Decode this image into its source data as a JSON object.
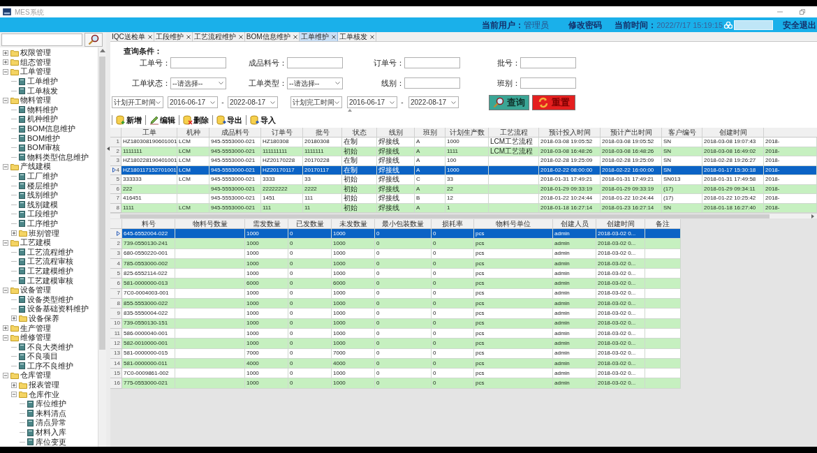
{
  "window": {
    "title": "MES系统"
  },
  "header": {
    "user_label": "当前用户：",
    "user_name": "管理员",
    "change_password": "修改密码",
    "time_label": "当前时间：",
    "time_value": "2022/7/17 15:19:15",
    "logout": "安全退出"
  },
  "sidebar": {
    "tree": [
      {
        "label": "权限管理",
        "kind": "folder",
        "expanded": false
      },
      {
        "label": "组态管理",
        "kind": "folder",
        "expanded": false
      },
      {
        "label": "工单管理",
        "kind": "folder",
        "expanded": true,
        "children": [
          {
            "label": "工单维护",
            "kind": "page"
          },
          {
            "label": "工单核发",
            "kind": "page"
          }
        ]
      },
      {
        "label": "物料管理",
        "kind": "folder",
        "expanded": true,
        "children": [
          {
            "label": "物料维护",
            "kind": "page"
          },
          {
            "label": "机种维护",
            "kind": "page"
          },
          {
            "label": "BOM信息维护",
            "kind": "page"
          },
          {
            "label": "BOM维护",
            "kind": "page"
          },
          {
            "label": "BOM审核",
            "kind": "page"
          },
          {
            "label": "物料类型信息维护",
            "kind": "page"
          }
        ]
      },
      {
        "label": "产线建模",
        "kind": "folder",
        "expanded": true,
        "children": [
          {
            "label": "工厂维护",
            "kind": "page"
          },
          {
            "label": "楼层维护",
            "kind": "page"
          },
          {
            "label": "线别维护",
            "kind": "page"
          },
          {
            "label": "线别建模",
            "kind": "page"
          },
          {
            "label": "工段维护",
            "kind": "page"
          },
          {
            "label": "工序维护",
            "kind": "page"
          },
          {
            "label": "班别管理",
            "kind": "folder",
            "expanded": false
          }
        ]
      },
      {
        "label": "工艺建模",
        "kind": "folder",
        "expanded": true,
        "children": [
          {
            "label": "工艺流程维护",
            "kind": "page"
          },
          {
            "label": "工艺流程审核",
            "kind": "page"
          },
          {
            "label": "工艺建模维护",
            "kind": "page"
          },
          {
            "label": "工艺建模审核",
            "kind": "page"
          }
        ]
      },
      {
        "label": "设备管理",
        "kind": "folder",
        "expanded": true,
        "children": [
          {
            "label": "设备类型维护",
            "kind": "page"
          },
          {
            "label": "设备基础资料维护",
            "kind": "page"
          },
          {
            "label": "设备保养",
            "kind": "folder",
            "expanded": false
          }
        ]
      },
      {
        "label": "生产管理",
        "kind": "folder",
        "expanded": false
      },
      {
        "label": "维修管理",
        "kind": "folder",
        "expanded": true,
        "children": [
          {
            "label": "不良大类维护",
            "kind": "page"
          },
          {
            "label": "不良项目",
            "kind": "page"
          },
          {
            "label": "工序不良维护",
            "kind": "page"
          }
        ]
      },
      {
        "label": "仓库管理",
        "kind": "folder",
        "expanded": true,
        "children": [
          {
            "label": "报表管理",
            "kind": "folder",
            "expanded": false
          },
          {
            "label": "仓库作业",
            "kind": "folder",
            "expanded": true,
            "children": [
              {
                "label": "库位维护",
                "kind": "page"
              },
              {
                "label": "来料清点",
                "kind": "page"
              },
              {
                "label": "清点异常",
                "kind": "page"
              },
              {
                "label": "材料入库",
                "kind": "page"
              },
              {
                "label": "库位变更",
                "kind": "page"
              }
            ]
          }
        ]
      }
    ]
  },
  "tabs": [
    {
      "label": "IQC送检单",
      "selected": false
    },
    {
      "label": "工段维护",
      "selected": false
    },
    {
      "label": "工艺流程维护",
      "selected": false
    },
    {
      "label": "BOM信息维护",
      "selected": false
    },
    {
      "label": "工单维护",
      "selected": true
    },
    {
      "label": "工单核发",
      "selected": false
    }
  ],
  "query": {
    "title": "查询条件：",
    "fields": [
      {
        "label": "工单号：",
        "kind": "text"
      },
      {
        "label": "成品料号：",
        "kind": "text"
      },
      {
        "label": "订单号：",
        "kind": "text"
      },
      {
        "label": "批号：",
        "kind": "text"
      },
      {
        "label": "工单状态：",
        "kind": "select",
        "value": "--请选择--"
      },
      {
        "label": "工单类型：",
        "kind": "select",
        "value": "--请选择--"
      },
      {
        "label": "线别：",
        "kind": "text"
      },
      {
        "label": "班别：",
        "kind": "text"
      }
    ],
    "range": [
      {
        "kind": "select",
        "value": "计划开工时间"
      },
      {
        "kind": "date",
        "value": "2016-06-17"
      },
      {
        "kind": "dash",
        "value": "-"
      },
      {
        "kind": "date",
        "value": "2022-08-17"
      },
      {
        "kind": "select",
        "value": "计划完工时间"
      },
      {
        "kind": "date",
        "value": "2016-06-17"
      },
      {
        "kind": "dash",
        "value": "-"
      },
      {
        "kind": "date",
        "value": "2022-08-17"
      }
    ],
    "buttons": [
      {
        "label": "查询",
        "kind": "search"
      },
      {
        "label": "重置",
        "kind": "reset"
      }
    ]
  },
  "toolbar": [
    {
      "label": "新增",
      "kind": "add"
    },
    {
      "label": "编辑",
      "kind": "edit"
    },
    {
      "label": "删除",
      "kind": "delete"
    },
    {
      "label": "导出",
      "kind": "export"
    },
    {
      "label": "导入",
      "kind": "import"
    }
  ],
  "work_orders": {
    "columns": [
      "工单",
      "机种",
      "成品料号",
      "订单号",
      "批号",
      "状态",
      "线别",
      "班别",
      "计划生产数",
      "工艺流程",
      "预计投入时间",
      "预计产出时间",
      "客户编号",
      "创建时间"
    ],
    "rows": [
      {
        "no": "1",
        "selected": false,
        "cells": [
          "HZ180308190601001",
          "LCM",
          "945-5553000-021",
          "HZ180308",
          "20180308",
          "在制",
          "焊接线",
          "A",
          "1000",
          "LCM工艺流程",
          "2018-03-08 19:05:52",
          "2018-03-08 19:05:52",
          "SN",
          "2018-03-08 19:07:43",
          "2018-"
        ]
      },
      {
        "no": "2",
        "selected": false,
        "cells": [
          "1111111",
          "LCM",
          "945-5553000-021",
          "111111111",
          "1111111",
          "初始",
          "焊接线",
          "A",
          "1111",
          "LCM工艺流程",
          "2018-03-08 16:48:26",
          "2018-03-08 16:48:26",
          "SN",
          "2018-03-08 16:49:02",
          "2018-"
        ]
      },
      {
        "no": "3",
        "selected": false,
        "cells": [
          "HZ180228190401001",
          "LCM",
          "945-5553000-021",
          "HZ20170228",
          "20170228",
          "在制",
          "焊接线",
          "A",
          "100",
          null,
          "2018-02-28 19:25:09",
          "2018-02-28 19:25:09",
          "SN",
          "2018-02-28 19:26:27",
          "2018-"
        ]
      },
      {
        "no": "4",
        "selected": true,
        "cells": [
          "HZ180117152701001",
          "LCM",
          "945-5553000-021",
          "HZ20170117",
          "20170117",
          "在制",
          "焊接线",
          "A",
          "1000",
          null,
          "2018-02-22 08:00:00",
          "2018-02-22 16:00:00",
          "SN",
          "2018-01-17 15:30:18",
          "2018-"
        ]
      },
      {
        "no": "5",
        "selected": false,
        "cells": [
          "333333",
          "LCM",
          "945-5553000-021",
          "3333",
          "33",
          "初始",
          "焊接线",
          "C",
          "33",
          null,
          "2018-01-31 17:49:21",
          "2018-01-31 17:49:21",
          "SN013",
          "2018-01-31 17:49:58",
          "2018-"
        ]
      },
      {
        "no": "6",
        "selected": false,
        "cells": [
          "222",
          null,
          "945-5553000-021",
          "22222222",
          "2222",
          "初始",
          "焊接线",
          "A",
          "22",
          null,
          "2018-01-29 09:33:19",
          "2018-01-29 09:33:19",
          "(17)",
          "2018-01-29 09:34:11",
          "2018-"
        ]
      },
      {
        "no": "7",
        "selected": false,
        "cells": [
          "416451",
          null,
          "945-5553000-021",
          "1451",
          "111",
          "初始",
          "焊接线",
          "B",
          "12",
          null,
          "2018-01-22 10:24:44",
          "2018-01-22 10:24:44",
          "(17)",
          "2018-01-22 10:25:42",
          "2018-"
        ]
      },
      {
        "no": "8",
        "selected": false,
        "cells": [
          "1111",
          "LCM",
          "945-5553000-021",
          "111",
          "11",
          "初始",
          "焊接线",
          "A",
          "1",
          null,
          "2018-01-18 16:27:14",
          "2018-01-23 16:27:14",
          "SN",
          "2018-01-18 16:27:40",
          "2018-"
        ]
      }
    ]
  },
  "materials": {
    "columns": [
      "料号",
      "物料号数量",
      "需发数量",
      "已发数量",
      "未发数量",
      "最小包装数量",
      "损耗率",
      "物料号单位",
      "创建人员",
      "创建时间",
      "备注"
    ],
    "rows": [
      {
        "selected": true,
        "cells": [
          "645-6552004-022",
          null,
          "1000",
          "0",
          "1000",
          "0",
          "0",
          "pcs",
          "admin",
          "2018-03-02 0...",
          null
        ]
      },
      {
        "no": "2",
        "selected": false,
        "cells": [
          "739-0550130-241",
          null,
          "1000",
          "0",
          "1000",
          "0",
          "0",
          "pcs",
          "admin",
          "2018-03-02 0...",
          null
        ]
      },
      {
        "no": "3",
        "selected": false,
        "cells": [
          "680-0550220-001",
          null,
          "1000",
          "0",
          "1000",
          "0",
          "0",
          "pcs",
          "admin",
          "2018-03-02 0...",
          null
        ]
      },
      {
        "no": "4",
        "selected": false,
        "cells": [
          "785-0553000-002",
          null,
          "1000",
          "0",
          "1000",
          "0",
          "0",
          "pcs",
          "admin",
          "2018-03-02 0...",
          null
        ]
      },
      {
        "no": "5",
        "selected": false,
        "cells": [
          "825-6552114-022",
          null,
          "1000",
          "0",
          "1000",
          "0",
          "0",
          "pcs",
          "admin",
          "2018-03-02 0...",
          null
        ]
      },
      {
        "no": "6",
        "selected": false,
        "cells": [
          "581-0000000-013",
          null,
          "6000",
          "0",
          "6000",
          "0",
          "0",
          "pcs",
          "admin",
          "2018-03-02 0...",
          null
        ]
      },
      {
        "no": "7",
        "selected": false,
        "cells": [
          "7C0-0004003-001",
          null,
          "1000",
          "0",
          "1000",
          "0",
          "0",
          "pcs",
          "admin",
          "2018-03-02 0...",
          null
        ]
      },
      {
        "no": "8",
        "selected": false,
        "cells": [
          "855-5553000-022",
          null,
          "1000",
          "0",
          "1000",
          "0",
          "0",
          "pcs",
          "admin",
          "2018-03-02 0...",
          null
        ]
      },
      {
        "no": "9",
        "selected": false,
        "cells": [
          "835-5550004-022",
          null,
          "1000",
          "0",
          "1000",
          "0",
          "0",
          "pcs",
          "admin",
          "2018-03-02 0...",
          null
        ]
      },
      {
        "no": "10",
        "selected": false,
        "cells": [
          "739-0550130-151",
          null,
          "1000",
          "0",
          "1000",
          "0",
          "0",
          "pcs",
          "admin",
          "2018-03-02 0...",
          null
        ]
      },
      {
        "no": "11",
        "selected": false,
        "cells": [
          "586-0000040-001",
          null,
          "1000",
          "0",
          "1000",
          "0",
          "0",
          "pcs",
          "admin",
          "2018-03-02 0...",
          null
        ]
      },
      {
        "no": "12",
        "selected": false,
        "cells": [
          "582-0010000-001",
          null,
          "1000",
          "0",
          "1000",
          "0",
          "0",
          "pcs",
          "admin",
          "2018-03-02 0...",
          null
        ]
      },
      {
        "no": "13",
        "selected": false,
        "cells": [
          "581-0000000-015",
          null,
          "7000",
          "0",
          "7000",
          "0",
          "0",
          "pcs",
          "admin",
          "2018-03-02 0...",
          null
        ]
      },
      {
        "no": "14",
        "selected": false,
        "cells": [
          "581-0000000-011",
          null,
          "4000",
          "0",
          "4000",
          "0",
          "0",
          "pcs",
          "admin",
          "2018-03-02 0...",
          null
        ]
      },
      {
        "no": "15",
        "selected": false,
        "cells": [
          "7C0-0009861-002",
          null,
          "1000",
          "0",
          "1000",
          "0",
          "0",
          "pcs",
          "admin",
          "2018-03-02 0...",
          null
        ]
      },
      {
        "no": "16",
        "selected": false,
        "cells": [
          "775-0553000-021",
          null,
          "1000",
          "0",
          "1000",
          "0",
          "0",
          "pcs",
          "admin",
          "2018-03-02 0...",
          null
        ]
      }
    ]
  }
}
